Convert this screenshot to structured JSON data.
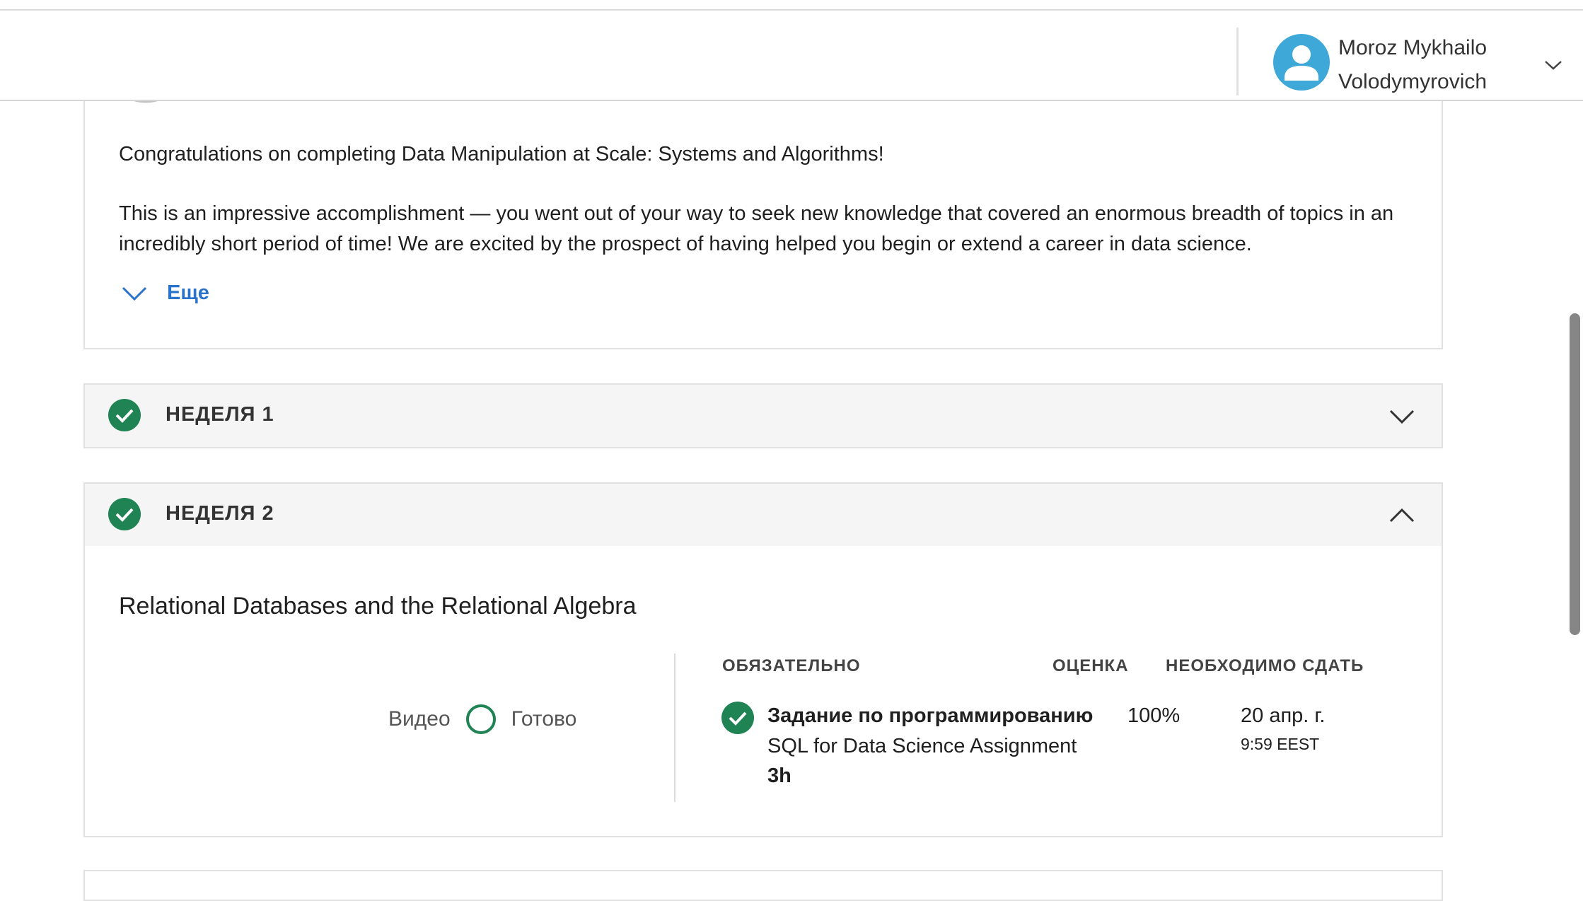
{
  "header": {
    "user_name_line1": "Moroz Mykhailo",
    "user_name_line2": "Volodymyrovich"
  },
  "intro": {
    "paragraph1": "Congratulations on completing Data Manipulation at Scale: Systems and Algorithms!",
    "paragraph2": "This is an impressive accomplishment — you went out of your way to seek new knowledge that covered an enormous breadth of topics in an incredibly short period of time! We are excited by the prospect of having helped you begin or extend a career in data science.",
    "more_label": "Еще"
  },
  "weeks": [
    {
      "label": "НЕДЕЛЯ 1",
      "completed": true,
      "expanded": false
    },
    {
      "label": "НЕДЕЛЯ 2",
      "completed": true,
      "expanded": true
    }
  ],
  "week2": {
    "section_title": "Relational Databases and the Relational Algebra",
    "video_label": "Видео",
    "video_status": "Готово",
    "columns": {
      "required": "ОБЯЗАТЕЛЬНО",
      "grade": "ОЦЕНКА",
      "due": "НЕОБХОДИМО СДАТЬ"
    },
    "assignment": {
      "type": "Задание по программированию",
      "name": "SQL for Data Science Assignment",
      "duration": "3h",
      "grade": "100%",
      "due_date": "20 апр. г.",
      "due_time": "9:59 EEST"
    }
  },
  "colors": {
    "accent_green": "#1f8354",
    "link_blue": "#2a73cc",
    "avatar_blue": "#3ea8d8"
  },
  "icons": [
    "user-avatar-icon",
    "chevron-down-icon",
    "chevron-up-icon",
    "check-circle-icon",
    "empty-circle-icon"
  ]
}
